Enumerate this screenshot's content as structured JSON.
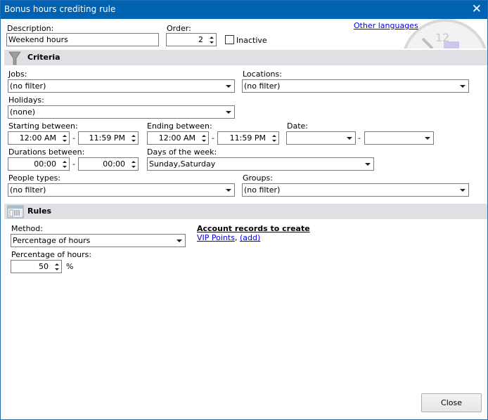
{
  "window": {
    "title": "Bonus hours crediting rule",
    "close_icon": "close-icon"
  },
  "header": {
    "description_label": "Description:",
    "description_value": "Weekend hours",
    "order_label": "Order:",
    "order_value": "2",
    "inactive_label": "Inactive",
    "inactive_checked": false,
    "other_languages_link": "Other languages"
  },
  "criteria": {
    "section_title": "Criteria",
    "icon": "funnel-icon",
    "jobs_label": "Jobs:",
    "jobs_value": "(no filter)",
    "locations_label": "Locations:",
    "locations_value": "(no filter)",
    "holidays_label": "Holidays:",
    "holidays_value": "(none)",
    "starting_label": "Starting between:",
    "starting_from": "12:00 AM",
    "starting_to": "11:59 PM",
    "ending_label": "Ending between:",
    "ending_from": "12:00 AM",
    "ending_to": "11:59 PM",
    "date_label": "Date:",
    "date_from": "",
    "date_to": "",
    "durations_label": "Durations between:",
    "duration_from": "00:00",
    "duration_to": "00:00",
    "days_label": "Days of the week:",
    "days_value": "Sunday,Saturday",
    "people_types_label": "People types:",
    "people_types_value": "(no filter)",
    "groups_label": "Groups:",
    "groups_value": "(no filter)",
    "range_separator": "-"
  },
  "rules": {
    "section_title": "Rules",
    "icon": "rules-icon",
    "method_label": "Method:",
    "method_value": "Percentage of hours",
    "percentage_label": "Percentage of hours:",
    "percentage_value": "50",
    "percent_sign": "%",
    "account_records_title": "Account records to create",
    "account_record_link": "VIP Points",
    "account_separator": ",",
    "add_link": "(add)"
  },
  "footer": {
    "close_button": "Close"
  }
}
